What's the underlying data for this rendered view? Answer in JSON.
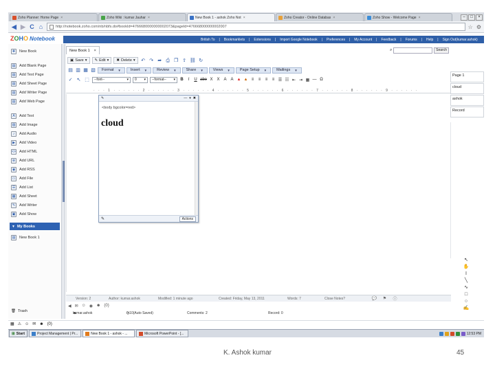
{
  "browser": {
    "tabs": [
      {
        "label": "Zoho Planner: Home Page",
        "color": "#d9502b",
        "active": false
      },
      {
        "label": "Zoho Wiki : kumar Jauhar",
        "color": "#48a448",
        "active": false
      },
      {
        "label": "New Book 1 - ashok Zoho Not",
        "color": "#3a72c6",
        "active": true
      },
      {
        "label": "Zoho Creator - Online Databas",
        "color": "#e8a13a",
        "active": false
      },
      {
        "label": "Zoho Show - Welcome Page",
        "color": "#3c8dd8",
        "active": false
      }
    ],
    "address": "http://notebook.zoho.com/nb/nbfs.do#bookId=4766680000000002073&pageId=476668000000002007"
  },
  "app": {
    "logo_zoho": [
      "Z",
      "O",
      "H",
      "O"
    ],
    "logo_notebook": "Notebook",
    "top_links": [
      "British To",
      "Bookmarklets",
      "Extensions",
      "Import Google Notebook",
      "Preferences",
      "My Account",
      "Feedback",
      "Forums",
      "Help",
      "Sign Out(kumar.ashok)"
    ]
  },
  "sidebar": {
    "new_book": "New Book",
    "pages": [
      {
        "icon": "blank-page-icon",
        "label": "Add Blank Page"
      },
      {
        "icon": "text-page-icon",
        "label": "Add Text Page"
      },
      {
        "icon": "sheet-page-icon",
        "label": "Add Sheet Page"
      },
      {
        "icon": "writer-page-icon",
        "label": "Add Writer Page"
      },
      {
        "icon": "web-page-icon",
        "label": "Add Web Page"
      }
    ],
    "objects": [
      {
        "icon": "text-icon",
        "label": "Add Text"
      },
      {
        "icon": "image-icon",
        "label": "Add Image"
      },
      {
        "icon": "audio-icon",
        "label": "Add Audio"
      },
      {
        "icon": "video-icon",
        "label": "Add Video"
      },
      {
        "icon": "html-icon",
        "label": "Add HTML"
      },
      {
        "icon": "url-icon",
        "label": "Add URL"
      },
      {
        "icon": "rss-icon",
        "label": "Add RSS"
      },
      {
        "icon": "file-icon",
        "label": "Add File"
      },
      {
        "icon": "list-icon",
        "label": "Add List"
      },
      {
        "icon": "sheet-icon",
        "label": "Add Sheet"
      },
      {
        "icon": "writer-icon",
        "label": "Add Writer"
      },
      {
        "icon": "show-icon",
        "label": "Add Show"
      }
    ],
    "section": "My Books",
    "books": [
      "New Book 1"
    ],
    "trash": "Trash"
  },
  "editor": {
    "doc_tab": "New Book 1",
    "search_button": "Search",
    "toolbar": [
      "Save",
      "Edit",
      "Delete"
    ],
    "menus": [
      "Format",
      "Insert",
      "Review",
      "Share",
      "Views",
      "Page Setup",
      "Mailings"
    ],
    "font_select": "--font--",
    "size_select": "0",
    "format_select": "--format--",
    "format_glyphs": [
      "B",
      "I",
      "U",
      "abe",
      "X",
      "X",
      "A",
      "A"
    ],
    "panel": {
      "source": "<body bgcolor=red>",
      "content": "cloud",
      "actions_button": "Actions"
    },
    "right_items": [
      "Page 1",
      "cloud",
      "ashok",
      "Record"
    ],
    "status": {
      "version": "Version: 2",
      "author": "Author: kumar.ashok",
      "modified": "Modified: 1 minute ago",
      "created": "Created: Friday, May 13, 2011",
      "words": "Words: 7",
      "close": "Close Notes?"
    },
    "file_row": {
      "name": "kumar.ashok",
      "autosave": "0:10(Auto Saved)",
      "comments": "Comments: 2",
      "record": "Record: 0"
    },
    "count_label": "(0)"
  },
  "taskbar": {
    "start": "Start",
    "tasks": [
      {
        "label": "Project Management | Pr...",
        "color": "#3c7fc9",
        "active": false
      },
      {
        "label": "New Book 1 - ashok - ...",
        "color": "#e07a1d",
        "active": true
      },
      {
        "label": "Microsoft PowerPoint - [...",
        "color": "#d24b2a",
        "active": false
      }
    ],
    "time": "12:53 PM"
  },
  "footer": {
    "author": "K. Ashok kumar",
    "page": "45"
  }
}
